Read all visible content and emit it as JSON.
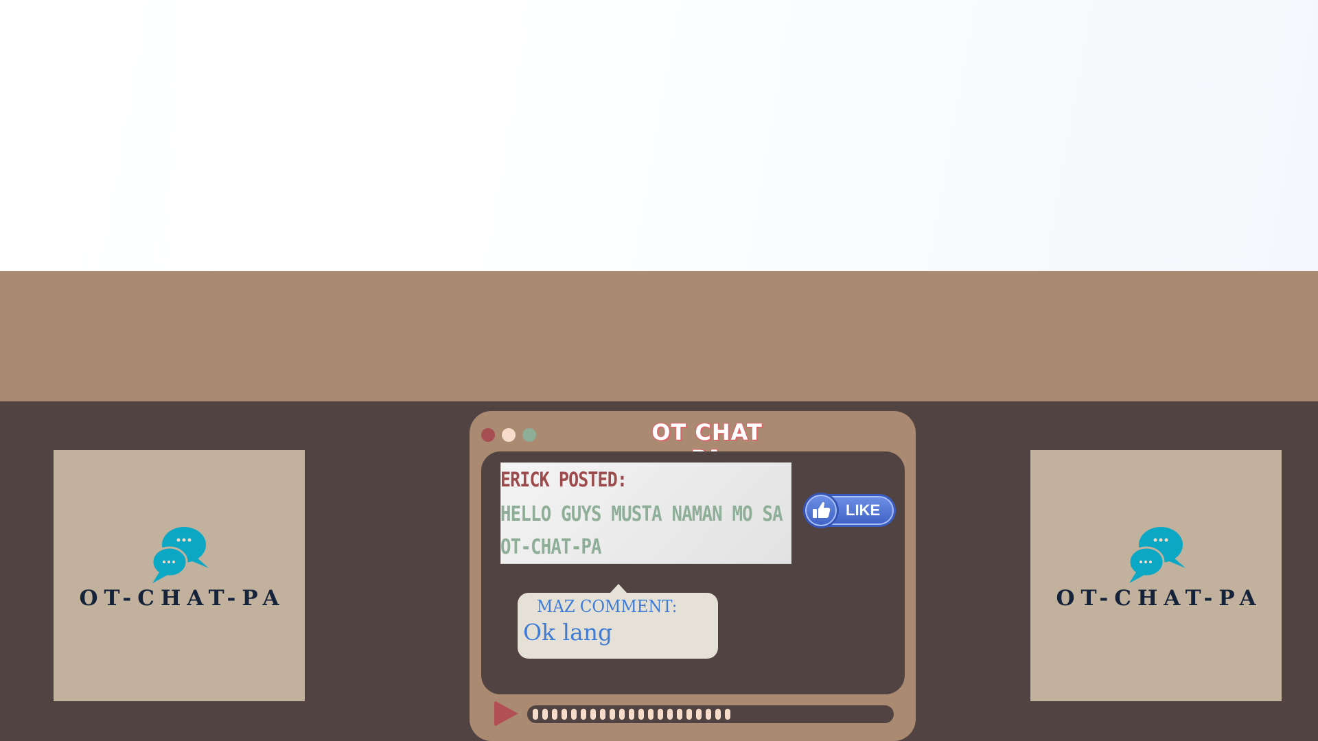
{
  "logo_cards": [
    {
      "brand": "OT-CHAT-PA",
      "icon": "chat-bubbles-icon"
    },
    {
      "brand": "OT-CHAT-PA",
      "icon": "chat-bubbles-icon"
    }
  ],
  "window": {
    "title": "OT CHAT PA",
    "controls": [
      "close-dot",
      "minimize-dot",
      "maximize-dot"
    ],
    "post": {
      "header": "ERICK POSTED:",
      "body": "HELLO GUYS MUSTA NAMAN MO SA OT-CHAT-PA"
    },
    "like_button": {
      "label": "LIKE",
      "icon": "thumbs-up-icon"
    },
    "comment": {
      "header": "MAZ COMMENT:",
      "body": "Ok lang"
    },
    "player": {
      "icon": "play-icon",
      "progress": 0.57
    }
  },
  "colors": {
    "tan": "#ab8a72",
    "dark_brown": "#514341",
    "card": "#c1b19d",
    "accent_red": "#a64e51",
    "accent_green": "#8fae98",
    "teal": "#0aa8c4",
    "like_blue": "#3e61c4",
    "comment_blue": "#3e7bd6"
  }
}
